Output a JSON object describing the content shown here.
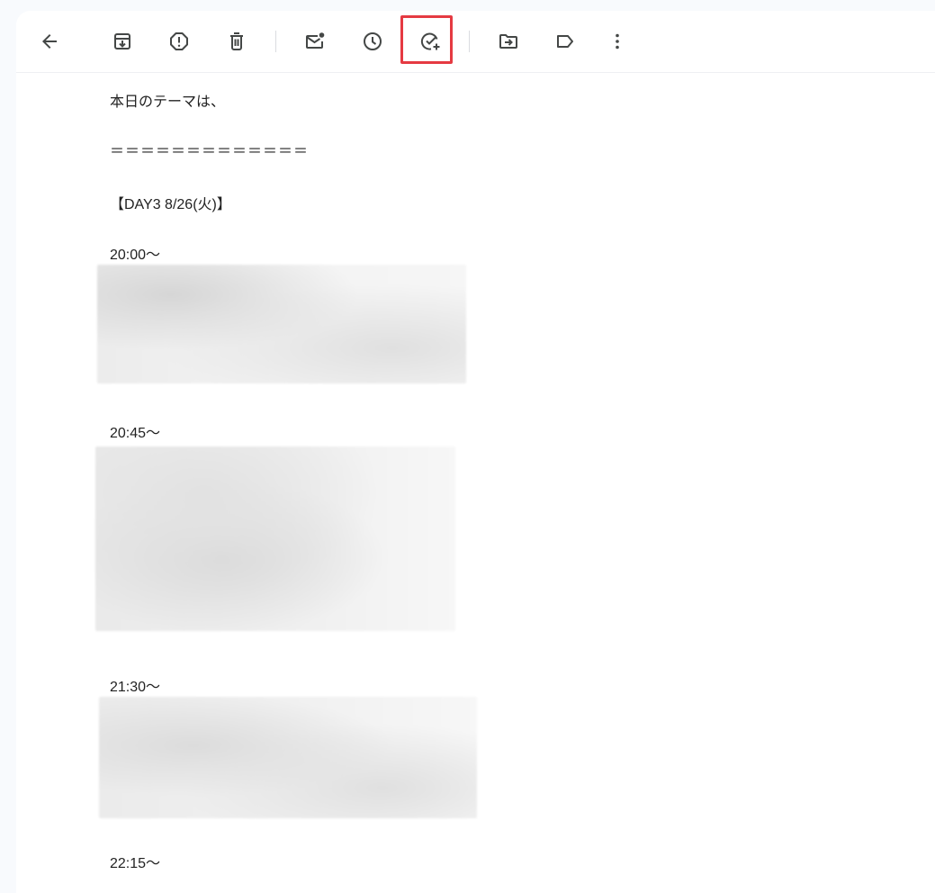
{
  "toolbar": {
    "buttons": [
      {
        "name": "back",
        "icon": "arrow-back-icon"
      },
      {
        "name": "archive",
        "icon": "archive-icon"
      },
      {
        "name": "report-spam",
        "icon": "report-spam-icon"
      },
      {
        "name": "delete",
        "icon": "trash-icon"
      },
      {
        "name": "mark-unread",
        "icon": "mark-unread-icon"
      },
      {
        "name": "snooze",
        "icon": "clock-icon"
      },
      {
        "name": "add-to-tasks",
        "icon": "add-task-icon",
        "highlighted": true
      },
      {
        "name": "move-to",
        "icon": "move-to-folder-icon"
      },
      {
        "name": "labels",
        "icon": "label-icon"
      },
      {
        "name": "more",
        "icon": "more-vert-icon"
      }
    ],
    "highlight_color": "#e53a42"
  },
  "email": {
    "intro": "本日のテーマは、",
    "separator": "＝＝＝＝＝＝＝＝＝＝＝＝＝",
    "day_heading": "【DAY3 8/26(火)】",
    "sessions": [
      {
        "time": "20:00～"
      },
      {
        "time": "20:45～"
      },
      {
        "time": "21:30～"
      },
      {
        "time": "22:15～"
      }
    ]
  }
}
